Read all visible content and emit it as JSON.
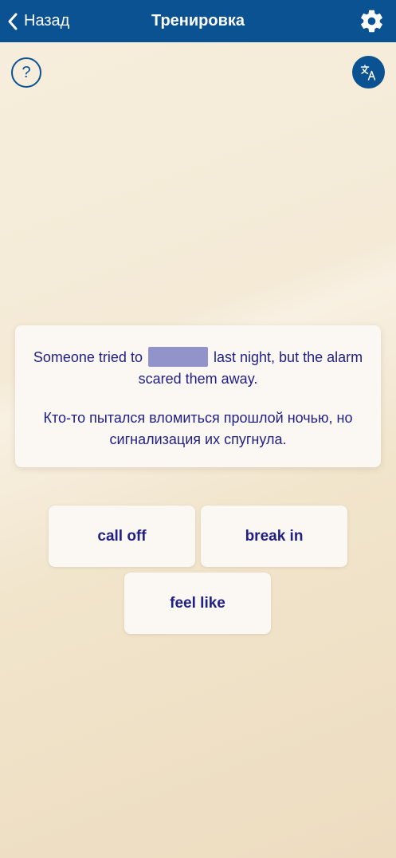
{
  "header": {
    "back_label": "Назад",
    "title": "Тренировка"
  },
  "help_label": "?",
  "exercise": {
    "sentence_before": "Someone tried to",
    "sentence_after": "last night, but the alarm scared them away.",
    "translation": "Кто-то пытался вломиться прошлой ночью, но сигнализация их спугнула."
  },
  "options": [
    {
      "label": "call off"
    },
    {
      "label": "break in"
    },
    {
      "label": "feel like"
    }
  ],
  "colors": {
    "brand": "#0b5293",
    "text": "#1f1f86",
    "blank": "#9393cc"
  },
  "icons": {
    "back": "chevron-left-icon",
    "settings": "gear-icon",
    "translate": "translate-icon"
  }
}
